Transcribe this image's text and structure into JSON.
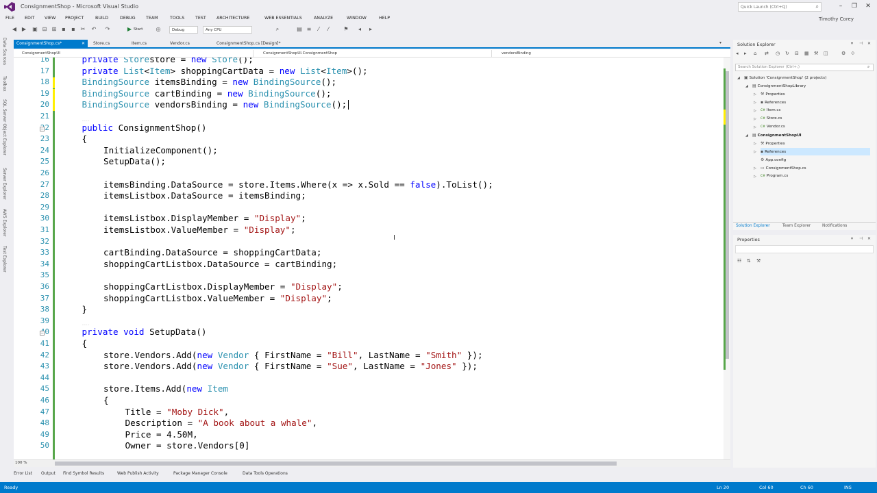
{
  "window": {
    "title": "ConsignmentShop - Microsoft Visual Studio",
    "quick_launch_placeholder": "Quick Launch (Ctrl+Q)",
    "user": "Timothy Corey"
  },
  "menu": [
    "FILE",
    "EDIT",
    "VIEW",
    "PROJECT",
    "BUILD",
    "DEBUG",
    "TEAM",
    "TOOLS",
    "TEST",
    "ARCHITECTURE",
    "WEB ESSENTIALS",
    "ANALYZE",
    "WINDOW",
    "HELP"
  ],
  "toolbar": {
    "start_label": "Start",
    "config": "Debug",
    "platform": "Any CPU"
  },
  "left_rail": [
    "Data Sources",
    "Toolbox",
    "SQL Server Object Explorer",
    "Server Explorer",
    "AWS Explorer",
    "Test Explorer"
  ],
  "doc_tabs": [
    {
      "label": "ConsignmentShop.cs*",
      "active": true
    },
    {
      "label": "Store.cs",
      "active": false
    },
    {
      "label": "Item.cs",
      "active": false
    },
    {
      "label": "Vendor.cs",
      "active": false
    },
    {
      "label": "ConsignmentShop.cs [Design]*",
      "active": false
    }
  ],
  "navbar": {
    "project": "ConsignmentShopUI",
    "type": "ConsignmentShopUI.ConsignmentShop",
    "member": "vendorsBinding"
  },
  "code_lines": [
    {
      "n": "16",
      "indent": 1,
      "tokens": [
        [
          "kw",
          "private "
        ],
        [
          "ty",
          "Store"
        ],
        [
          "",
          "store = "
        ],
        [
          "kw",
          "new "
        ],
        [
          "ty",
          "Store"
        ],
        [
          "",
          "();"
        ]
      ]
    },
    {
      "n": "17",
      "indent": 1,
      "tokens": [
        [
          "kw",
          "private "
        ],
        [
          "ty",
          "List"
        ],
        [
          "",
          "<"
        ],
        [
          "ty",
          "Item"
        ],
        [
          "",
          "> shoppingCartData = "
        ],
        [
          "kw",
          "new "
        ],
        [
          "ty",
          "List"
        ],
        [
          "",
          "<"
        ],
        [
          "ty",
          "Item"
        ],
        [
          "",
          ">();"
        ]
      ]
    },
    {
      "n": "18",
      "indent": 1,
      "tokens": [
        [
          "ty",
          "BindingSource"
        ],
        [
          "",
          " itemsBinding = "
        ],
        [
          "kw",
          "new "
        ],
        [
          "ty",
          "BindingSource"
        ],
        [
          "",
          "();"
        ]
      ]
    },
    {
      "n": "19",
      "indent": 1,
      "tokens": [
        [
          "ty",
          "BindingSource"
        ],
        [
          "",
          " cartBinding = "
        ],
        [
          "kw",
          "new "
        ],
        [
          "ty",
          "BindingSource"
        ],
        [
          "",
          "();"
        ]
      ]
    },
    {
      "n": "20",
      "indent": 1,
      "tokens": [
        [
          "ty",
          "BindingSource"
        ],
        [
          "",
          " vendorsBinding = "
        ],
        [
          "kw",
          "new "
        ],
        [
          "ty",
          "BindingSource"
        ],
        [
          "",
          "();"
        ]
      ]
    },
    {
      "n": "21",
      "indent": 0,
      "tokens": []
    },
    {
      "n": "22",
      "indent": 1,
      "tokens": [
        [
          "kw",
          "public "
        ],
        [
          "",
          "ConsignmentShop()"
        ]
      ]
    },
    {
      "n": "23",
      "indent": 1,
      "tokens": [
        [
          "",
          "{"
        ]
      ]
    },
    {
      "n": "24",
      "indent": 2,
      "tokens": [
        [
          "",
          "InitializeComponent();"
        ]
      ]
    },
    {
      "n": "25",
      "indent": 2,
      "tokens": [
        [
          "",
          "SetupData();"
        ]
      ]
    },
    {
      "n": "26",
      "indent": 0,
      "tokens": []
    },
    {
      "n": "27",
      "indent": 2,
      "tokens": [
        [
          "",
          "itemsBinding.DataSource = store.Items.Where(x => x.Sold == "
        ],
        [
          "kw",
          "false"
        ],
        [
          "",
          ").ToList();"
        ]
      ]
    },
    {
      "n": "28",
      "indent": 2,
      "tokens": [
        [
          "",
          "itemsListbox.DataSource = itemsBinding;"
        ]
      ]
    },
    {
      "n": "29",
      "indent": 0,
      "tokens": []
    },
    {
      "n": "30",
      "indent": 2,
      "tokens": [
        [
          "",
          "itemsListbox.DisplayMember = "
        ],
        [
          "st",
          "\"Display\""
        ],
        [
          "",
          ";"
        ]
      ]
    },
    {
      "n": "31",
      "indent": 2,
      "tokens": [
        [
          "",
          "itemsListbox.ValueMember = "
        ],
        [
          "st",
          "\"Display\""
        ],
        [
          "",
          ";"
        ]
      ]
    },
    {
      "n": "32",
      "indent": 0,
      "tokens": []
    },
    {
      "n": "33",
      "indent": 2,
      "tokens": [
        [
          "",
          "cartBinding.DataSource = shoppingCartData;"
        ]
      ]
    },
    {
      "n": "34",
      "indent": 2,
      "tokens": [
        [
          "",
          "shoppingCartListbox.DataSource = cartBinding;"
        ]
      ]
    },
    {
      "n": "35",
      "indent": 0,
      "tokens": []
    },
    {
      "n": "36",
      "indent": 2,
      "tokens": [
        [
          "",
          "shoppingCartListbox.DisplayMember = "
        ],
        [
          "st",
          "\"Display\""
        ],
        [
          "",
          ";"
        ]
      ]
    },
    {
      "n": "37",
      "indent": 2,
      "tokens": [
        [
          "",
          "shoppingCartListbox.ValueMember = "
        ],
        [
          "st",
          "\"Display\""
        ],
        [
          "",
          ";"
        ]
      ]
    },
    {
      "n": "38",
      "indent": 1,
      "tokens": [
        [
          "",
          "}"
        ]
      ]
    },
    {
      "n": "39",
      "indent": 0,
      "tokens": []
    },
    {
      "n": "40",
      "indent": 1,
      "tokens": [
        [
          "kw",
          "private void "
        ],
        [
          "",
          "SetupData()"
        ]
      ]
    },
    {
      "n": "41",
      "indent": 1,
      "tokens": [
        [
          "",
          "{"
        ]
      ]
    },
    {
      "n": "42",
      "indent": 2,
      "tokens": [
        [
          "",
          "store.Vendors.Add("
        ],
        [
          "kw",
          "new "
        ],
        [
          "ty",
          "Vendor"
        ],
        [
          "",
          " { FirstName = "
        ],
        [
          "st",
          "\"Bill\""
        ],
        [
          "",
          ", LastName = "
        ],
        [
          "st",
          "\"Smith\""
        ],
        [
          "",
          " });"
        ]
      ]
    },
    {
      "n": "43",
      "indent": 2,
      "tokens": [
        [
          "",
          "store.Vendors.Add("
        ],
        [
          "kw",
          "new "
        ],
        [
          "ty",
          "Vendor"
        ],
        [
          "",
          " { FirstName = "
        ],
        [
          "st",
          "\"Sue\""
        ],
        [
          "",
          ", LastName = "
        ],
        [
          "st",
          "\"Jones\""
        ],
        [
          "",
          " });"
        ]
      ]
    },
    {
      "n": "44",
      "indent": 0,
      "tokens": []
    },
    {
      "n": "45",
      "indent": 2,
      "tokens": [
        [
          "",
          "store.Items.Add("
        ],
        [
          "kw",
          "new "
        ],
        [
          "ty",
          "Item"
        ]
      ]
    },
    {
      "n": "46",
      "indent": 2,
      "tokens": [
        [
          "",
          "{"
        ]
      ]
    },
    {
      "n": "47",
      "indent": 3,
      "tokens": [
        [
          "",
          "Title = "
        ],
        [
          "st",
          "\"Moby Dick\""
        ],
        [
          "",
          ","
        ]
      ]
    },
    {
      "n": "48",
      "indent": 3,
      "tokens": [
        [
          "",
          "Description = "
        ],
        [
          "st",
          "\"A book about a whale\""
        ],
        [
          "",
          ","
        ]
      ]
    },
    {
      "n": "49",
      "indent": 3,
      "tokens": [
        [
          "",
          "Price = 4.50M,"
        ]
      ]
    },
    {
      "n": "50",
      "indent": 3,
      "tokens": [
        [
          "",
          "Owner = store.Vendors[0]"
        ]
      ]
    }
  ],
  "editor": {
    "zoom": "100 %"
  },
  "bottom_tabs": [
    "Error List",
    "Output",
    "Find Symbol Results",
    "Web Publish Activity",
    "Package Manager Console",
    "Data Tools Operations"
  ],
  "status": {
    "left": "Ready",
    "line": "Ln 20",
    "col": "Col 60",
    "ch": "Ch 60",
    "mode": "INS"
  },
  "solution_explorer": {
    "title": "Solution Explorer",
    "search_placeholder": "Search Solution Explorer (Ctrl+;)",
    "tree": [
      {
        "label": "Solution 'ConsignmentShop' (2 projects)",
        "level": 0,
        "expanded": true,
        "icon": "solution-icon"
      },
      {
        "label": "ConsignmentShopLibrary",
        "level": 1,
        "expanded": true,
        "icon": "csproj-icon"
      },
      {
        "label": "Properties",
        "level": 2,
        "expanded": false,
        "icon": "wrench-icon"
      },
      {
        "label": "References",
        "level": 2,
        "expanded": false,
        "icon": "references-icon"
      },
      {
        "label": "Item.cs",
        "level": 2,
        "expanded": false,
        "icon": "csfile-icon"
      },
      {
        "label": "Store.cs",
        "level": 2,
        "expanded": false,
        "icon": "csfile-icon"
      },
      {
        "label": "Vendor.cs",
        "level": 2,
        "expanded": false,
        "icon": "csfile-icon"
      },
      {
        "label": "ConsignmentShopUI",
        "level": 1,
        "expanded": true,
        "icon": "csproj-icon",
        "bold": true
      },
      {
        "label": "Properties",
        "level": 2,
        "expanded": false,
        "icon": "wrench-icon"
      },
      {
        "label": "References",
        "level": 2,
        "expanded": false,
        "icon": "references-icon",
        "selected": true
      },
      {
        "label": "App.config",
        "level": 2,
        "expanded": null,
        "icon": "config-icon"
      },
      {
        "label": "ConsignmentShop.cs",
        "level": 2,
        "expanded": false,
        "icon": "form-icon"
      },
      {
        "label": "Program.cs",
        "level": 2,
        "expanded": false,
        "icon": "csfile-icon"
      }
    ],
    "tabs": [
      "Solution Explorer",
      "Team Explorer",
      "Notifications"
    ]
  },
  "properties": {
    "title": "Properties"
  },
  "colors": {
    "accent": "#007acc",
    "keyword": "#0000ff",
    "type": "#2b91af",
    "string": "#a31515",
    "changed": "#57a64a",
    "unsaved": "#ffef00"
  }
}
